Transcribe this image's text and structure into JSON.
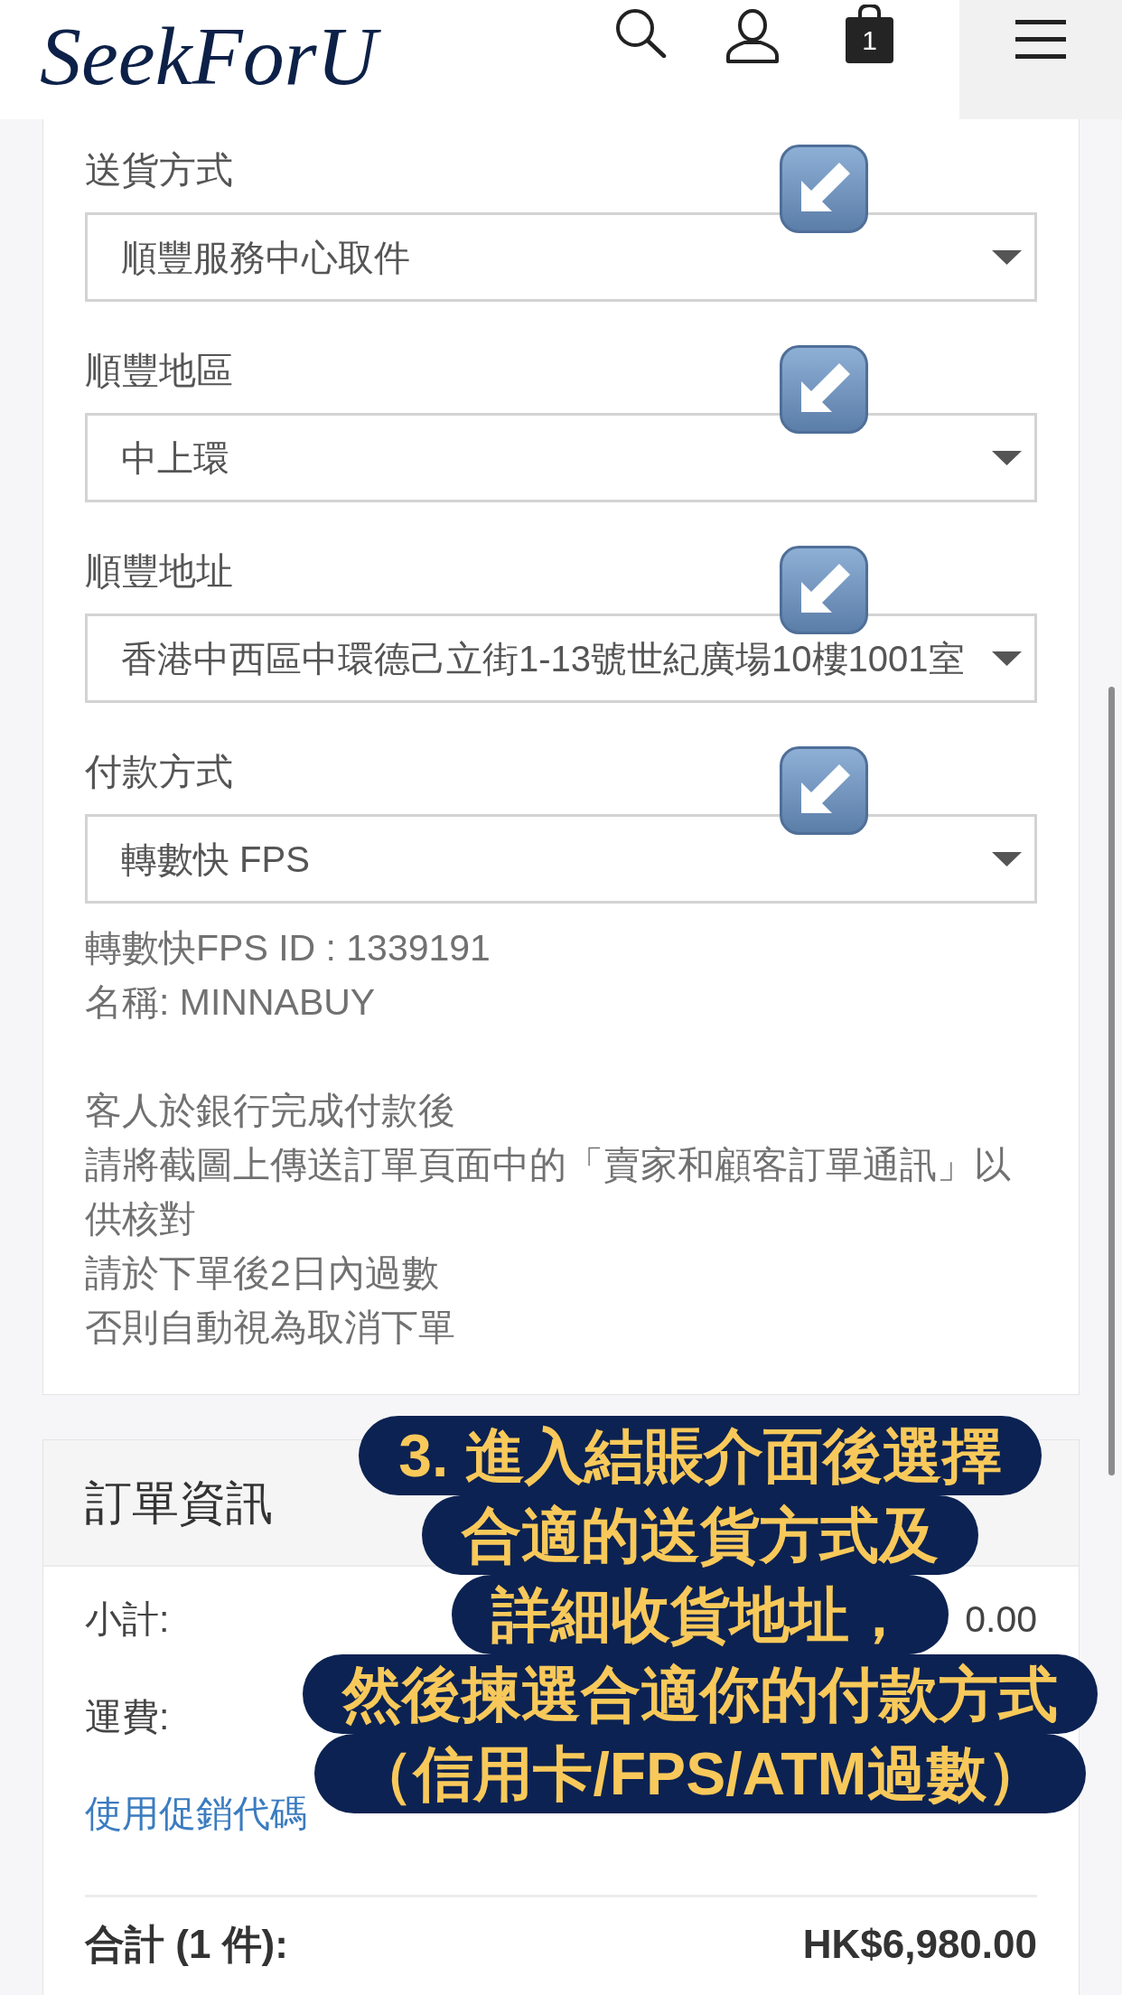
{
  "header": {
    "logo": "SeekForU",
    "cart_count": "1"
  },
  "delivery_form": {
    "fields": [
      {
        "label": "送貨方式",
        "value": "順豐服務中心取件",
        "arrow_marker": true
      },
      {
        "label": "順豐地區",
        "value": "中上環",
        "arrow_marker": true
      },
      {
        "label": "順豐地址",
        "value": "香港中西區中環德己立街1-13號世紀廣場10樓1001室",
        "arrow_marker": true
      },
      {
        "label": "付款方式",
        "value": "轉數快 FPS",
        "arrow_marker": true
      }
    ],
    "payment_details": [
      "轉數快FPS ID : 1339191",
      "名稱: MINNABUY"
    ],
    "payment_notes": [
      "客人於銀行完成付款後",
      "請將截圖上傳送訂單頁面中的「賣家和顧客訂單通訊」以供核對",
      "請於下單後2日內過數",
      "否則自動視為取消下單"
    ]
  },
  "order_summary": {
    "title": "訂單資訊",
    "rows": [
      {
        "label": "小計:",
        "value": "0.00"
      },
      {
        "label": "運費:"
      }
    ],
    "promo_link": "使用促銷代碼",
    "total": {
      "label": "合計 (1 件):",
      "value": "HK$6,980.00"
    }
  },
  "caption": {
    "lines": [
      "3. 進入結賬介面後選擇",
      "合適的送貨方式及",
      "詳細收貨地址，",
      "然後揀選合適你的付款方式",
      "（信用卡/FPS/ATM過數）"
    ]
  }
}
